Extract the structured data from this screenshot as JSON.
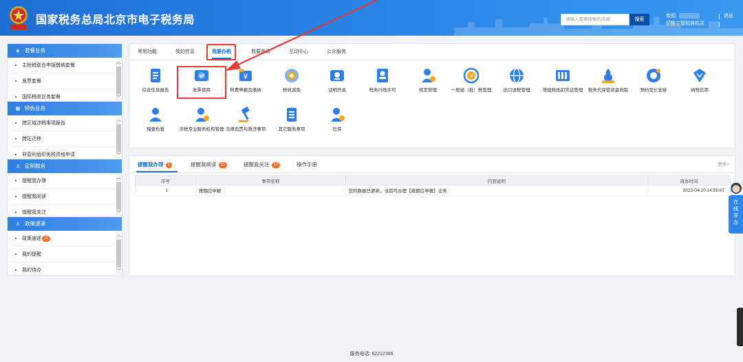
{
  "header": {
    "title": "国家税务总局北京市电子税务局",
    "search_placeholder": "请输入需要搜索的内容",
    "search_button": "搜索",
    "welcome": "欢迎,",
    "switch_agency": "切换主管税务机关",
    "logout": "退出"
  },
  "sidebar": {
    "section1": {
      "title": "套餐业务",
      "items": [
        "主附税联合申报缴纳套餐",
        "发票套餐",
        "国际税收业务套餐"
      ]
    },
    "section2": {
      "title": "特色业务",
      "items": [
        "跨区域涉税事项报告",
        "跨区迁移",
        "非营利组织免税资格申请"
      ]
    },
    "section3": {
      "title": "定制服务",
      "items": [
        "提醒我办理",
        "提醒我阅读",
        "提醒我关注"
      ]
    },
    "section4": {
      "title": "政策速递",
      "items": [
        "政策速递",
        "我的提醒",
        "我的待办"
      ],
      "badge": "11"
    }
  },
  "tabs": [
    "常用功能",
    "我的信息",
    "我要办税",
    "我要查询",
    "互动中心",
    "公众服务"
  ],
  "functions_row1": [
    {
      "label": "综合信息报告",
      "icon": "document-list-icon"
    },
    {
      "label": "发票使用",
      "icon": "invoice-check-icon"
    },
    {
      "label": "税费申报及缴纳",
      "icon": "tax-payment-icon"
    },
    {
      "label": "税收减免",
      "icon": "tax-reduction-icon"
    },
    {
      "label": "证明开具",
      "icon": "certificate-icon"
    },
    {
      "label": "税务行政许可",
      "icon": "admin-license-icon"
    },
    {
      "label": "核定管理",
      "icon": "assessment-icon"
    },
    {
      "label": "一般退（抵）税管理",
      "icon": "refund-icon"
    },
    {
      "label": "出口退税管理",
      "icon": "export-refund-icon"
    },
    {
      "label": "增值税抵扣凭证管理",
      "icon": "vat-voucher-icon"
    },
    {
      "label": "税务代保管资金收取",
      "icon": "custody-funds-icon"
    },
    {
      "label": "预约定价安排",
      "icon": "pricing-arrangement-icon"
    },
    {
      "label": "纳税信用",
      "icon": "tax-credit-icon"
    }
  ],
  "functions_row2": [
    {
      "label": "稽查检查",
      "icon": "inspection-icon"
    },
    {
      "label": "涉税专业服务机构管理",
      "icon": "agency-management-icon"
    },
    {
      "label": "法律追责与救济事项",
      "icon": "legal-remedy-icon"
    },
    {
      "label": "其它服务事项",
      "icon": "other-services-icon"
    },
    {
      "label": "社保",
      "icon": "social-security-icon"
    }
  ],
  "reminders": {
    "tabs": [
      {
        "label": "提醒我办理",
        "count": "1"
      },
      {
        "label": "提醒我阅读",
        "count": "11"
      },
      {
        "label": "提醒我关注",
        "count": "12"
      },
      {
        "label": "操作手册",
        "count": ""
      }
    ],
    "more": "更多>",
    "columns": [
      "序号",
      "事项名称",
      "内容说明",
      "待办时间"
    ],
    "rows": [
      {
        "no": "1",
        "name": "按期应申报",
        "desc": "您的数据已更新，当前可办理【按期应申报】业务",
        "time": "2022-04-20 14:55:07"
      }
    ]
  },
  "float_help": "在线导办",
  "footer": "服务电话: 62212366",
  "colors": {
    "header": "#1e6fd3",
    "accent": "#1e6fd3",
    "highlight": "#e53935",
    "badge": "#f36c21"
  }
}
